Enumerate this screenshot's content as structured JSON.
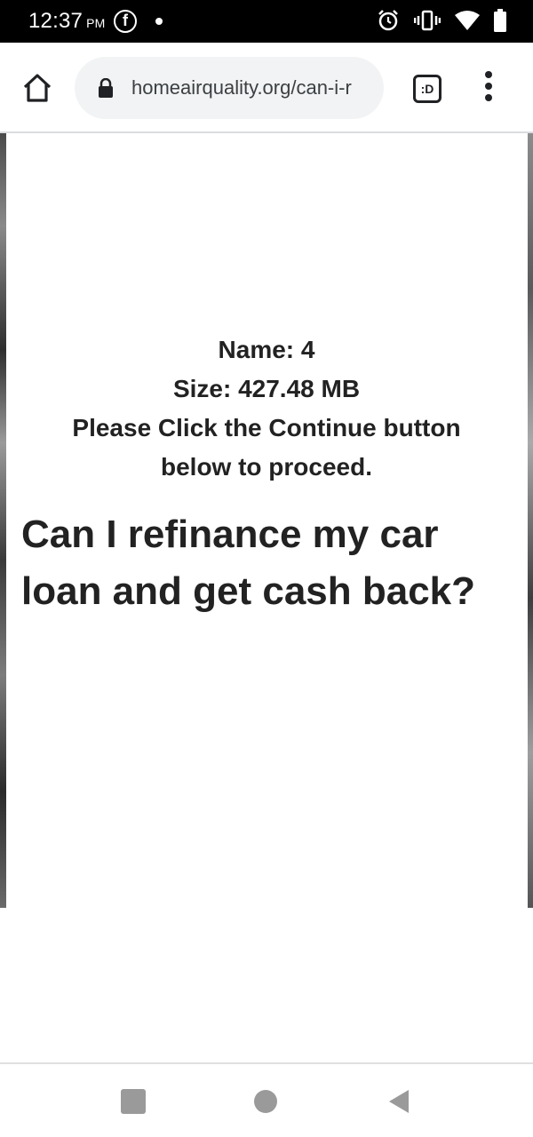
{
  "status_bar": {
    "time": "12:37",
    "ampm": "PM",
    "left_icons": [
      "facebook-icon",
      "notification-dot-icon"
    ],
    "right_icons": [
      "alarm-icon",
      "vibrate-icon",
      "wifi-icon",
      "battery-icon"
    ]
  },
  "browser": {
    "url": "homeairquality.org/can-i-r",
    "tabs_label": ":D",
    "icons": [
      "home-icon",
      "lock-icon",
      "tab-switcher-icon",
      "overflow-menu-icon"
    ]
  },
  "page": {
    "name_line": "Name: 4",
    "size_line": "Size: 427.48 MB",
    "instruction_line": "Please Click the Continue button below to proceed.",
    "title": "Can I refinance my car loan and get cash back?"
  },
  "nav_bar": {
    "icons": [
      "recents-icon",
      "home-circle-icon",
      "back-icon"
    ]
  },
  "colors": {
    "status_bar_bg": "#000000",
    "omnibox_bg": "#f1f3f4",
    "text": "#222222",
    "nav_icon": "#9a9a9a"
  }
}
